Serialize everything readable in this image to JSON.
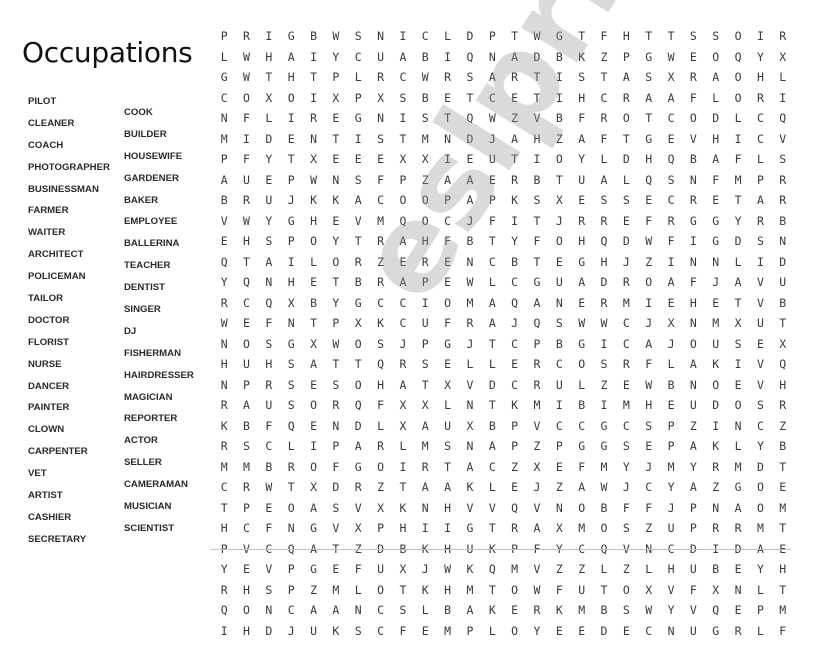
{
  "title": "Occupations",
  "word_list": {
    "column1": [
      "PILOT",
      "CLEANER",
      "COACH",
      "PHOTOGRAPHER",
      "BUSINESSMAN",
      "FARMER",
      "WAITER",
      "ARCHITECT",
      "POLICEMAN",
      "TAILOR",
      "DOCTOR",
      "FLORIST",
      "NURSE",
      "DANCER",
      "PAINTER",
      "CLOWN",
      "CARPENTER",
      "VET",
      "ARTIST",
      "CASHIER",
      "SECRETARY"
    ],
    "column2": [
      "COOK",
      "BUILDER",
      "HOUSEWIFE",
      "GARDENER",
      "BAKER",
      "EMPLOYEE",
      "BALLERINA",
      "TEACHER",
      "DENTIST",
      "SINGER",
      "DJ",
      "FISHERMAN",
      "HAIRDRESSER",
      "MAGICIAN",
      "REPORTER",
      "ACTOR",
      "SELLER",
      "CAMERAMAN",
      "MUSICIAN",
      "SCIENTIST"
    ]
  },
  "grid": [
    "PRIGBWSNICLDPTWGTFHTTSSOIRKKMY",
    "LWHAIYCUABIQNADBKZPGWEOQYXTALE",
    "GWTHTPLRCWRSARTISTASXRAOHLGETC",
    "COXOIXPXSBETCETIHCRAAFLORISTVI",
    "NFLIREGNISTQWZVBFROTCODLCQGLNP",
    "MIDENTISTMNDJAHZAFTGEVHICVUMZS",
    "PFYTXEEEXXIEUTIOYLDHQBAFLSCWGX",
    "AUEPWNSFPZAAERBTUALQSNFMPRWSPG",
    "BRUJKKACOOPAPKSXESSECRETARYVPF",
    "VWYGHEVMQOCJFITJRREFRGGYRBMIER",
    "EHSPOYTRAHFBTYFOHQDWFIGDSNDBPK",
    "QTAILORZERENCBTEGHJZINNLIDJANQ",
    "YQNHETBRAPEWLCGUADROAFJAVUVDRS",
    "RCQXBYGCCIOMAQANERMIEHETVBXAEX",
    "WEFNTPXKCUFRAJQSWWCJXNMXUTWDMQ",
    "NOSGXWOSJPGJTCPBGICAJOUSEXFURW",
    "HUHSATTQRSELLERCOSRFLAKIVQIRKAL",
    "NPRSESOHATXVDCRULZEWBNOEVHHFFQ",
    "RAUSORQFXXLNTKMIBIMHEUDOSRCARY",
    "KBFQENDLXAUXBPVCCGCSPZINCZOAMS",
    "RSCLIPARLMSNAPZPGGSEPAKLYBQKOJ",
    "MMBROFGOIRTACZXEFMYJMYRMDTQNKC",
    "CRWTXDRZTAAKLEJZAWJCYAZGOEEAXR",
    "TPEOASVXKNHVVQVNOBFFJPNAOMRMAE",
    "HCFNGVXPHIIGTRAXMOSZUPRRMTNRSI",
    "PVCQATZDBKHUKPFYCQVNCDIDAEOEAH",
    "YEVPGEFUXJWKQMVZZLZLHUBEYHZHYS",
    "RHSPZMLOTKHMTOWFUTOXVFXNLTNSPA",
    "QONCAANCSLBAKERKMBSWYVQEPMLICC",
    "IHDJUKSCFEMPLOYEEDECNUGRLFJFAI"
  ],
  "watermark": "eslprintables.com"
}
